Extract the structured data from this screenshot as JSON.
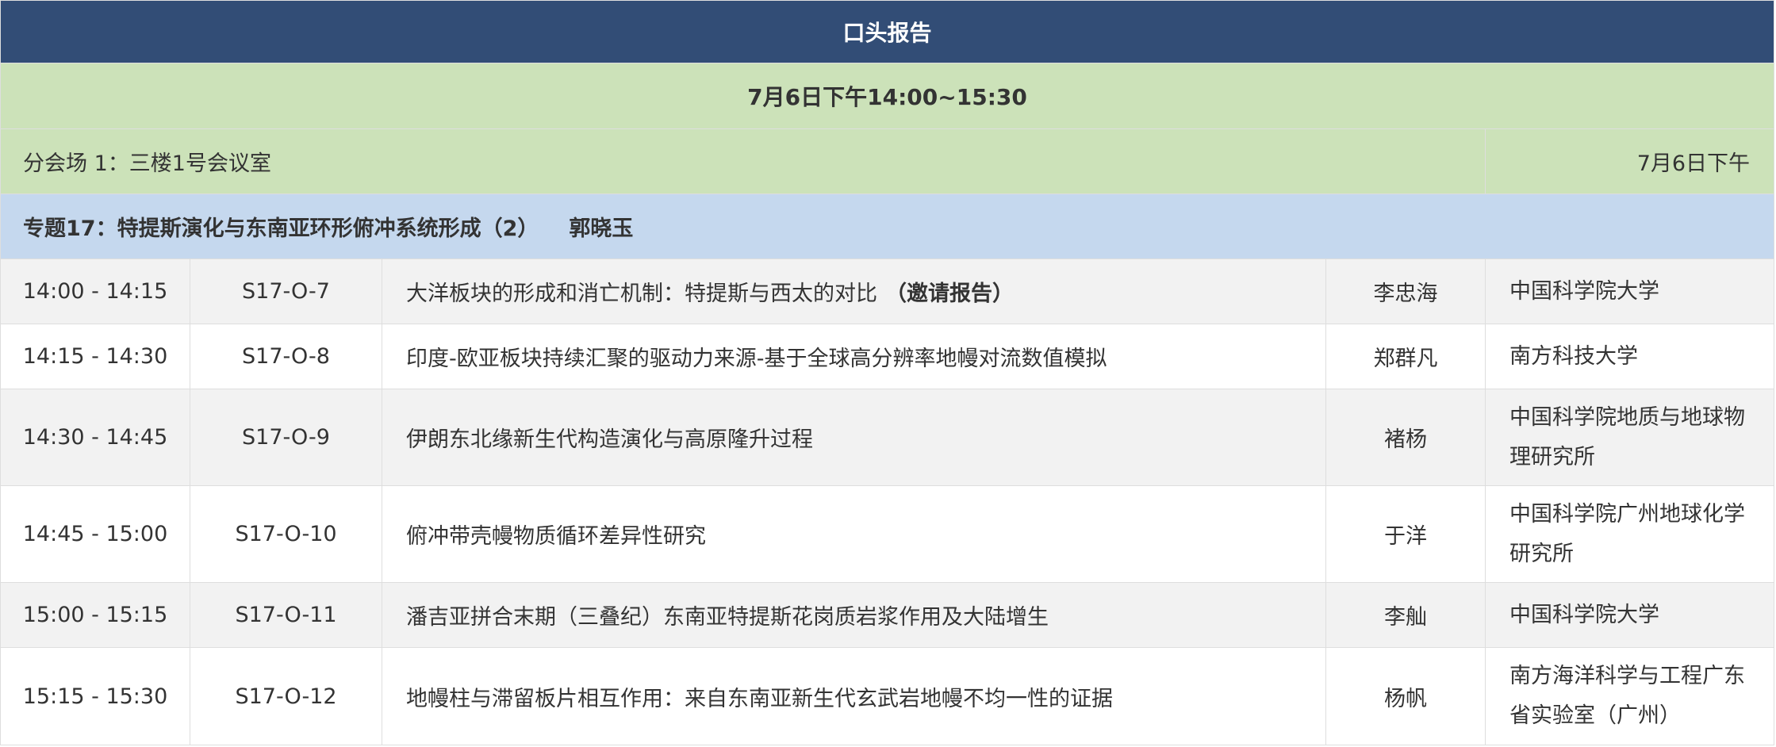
{
  "header": {
    "title": "口头报告"
  },
  "session": {
    "date_time": "7月6日下午14:00~15:30",
    "venue": "分会场 1：三楼1号会议室",
    "venue_date": "7月6日下午"
  },
  "topic": {
    "title": "专题17：特提斯演化与东南亚环形俯冲系统形成（2）",
    "chair": "郭晓玉"
  },
  "talks": [
    {
      "time": "14:00 - 14:15",
      "code": "S17-O-7",
      "title": "大洋板块的形成和消亡机制：特提斯与西太的对比",
      "tag": "（邀请报告）",
      "speaker": "李忠海",
      "affiliation": "中国科学院大学"
    },
    {
      "time": "14:15 - 14:30",
      "code": "S17-O-8",
      "title": "印度-欧亚板块持续汇聚的驱动力来源-基于全球高分辨率地幔对流数值模拟",
      "tag": "",
      "speaker": "郑群凡",
      "affiliation": "南方科技大学"
    },
    {
      "time": "14:30 - 14:45",
      "code": "S17-O-9",
      "title": "伊朗东北缘新生代构造演化与高原隆升过程",
      "tag": "",
      "speaker": "褚杨",
      "affiliation": "中国科学院地质与地球物理研究所"
    },
    {
      "time": "14:45 - 15:00",
      "code": "S17-O-10",
      "title": "俯冲带壳幔物质循环差异性研究",
      "tag": "",
      "speaker": "于洋",
      "affiliation": "中国科学院广州地球化学研究所"
    },
    {
      "time": "15:00 - 15:15",
      "code": "S17-O-11",
      "title": "潘吉亚拼合末期（三叠纪）东南亚特提斯花岗质岩浆作用及大陆增生",
      "tag": "",
      "speaker": "李舢",
      "affiliation": "中国科学院大学"
    },
    {
      "time": "15:15 - 15:30",
      "code": "S17-O-12",
      "title": "地幔柱与滞留板片相互作用：来自东南亚新生代玄武岩地幔不均一性的证据",
      "tag": "",
      "speaker": "杨帆",
      "affiliation": "南方海洋科学与工程广东省实验室（广州）"
    }
  ],
  "colors": {
    "header_bg": "#324d76",
    "date_bg": "#cce2b9",
    "topic_bg": "#c5d8ee",
    "alt_row_bg": "#f2f2f2"
  }
}
